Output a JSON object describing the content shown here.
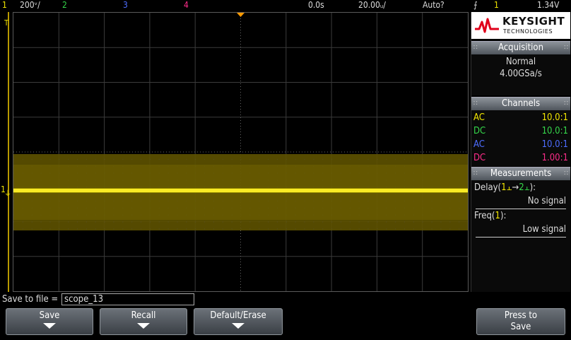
{
  "topbar": {
    "ch1_num": "1",
    "ch1_scale": "200ᵛ/",
    "ch2_num": "2",
    "ch3_num": "3",
    "ch4_num": "4",
    "delay": "0.0s",
    "timebase": "20.00ᵤ/",
    "trigger_mode": "Auto?",
    "trigger_ch": "1",
    "trigger_level": "1.34V"
  },
  "markers": {
    "trigger_t": "T",
    "ch1_ground": "1"
  },
  "logo": {
    "brand": "KEYSIGHT",
    "sub": "TECHNOLOGIES"
  },
  "acquisition": {
    "header": "Acquisition",
    "mode": "Normal",
    "rate": "4.00GSa/s"
  },
  "channels": {
    "header": "Channels",
    "rows": [
      {
        "coupling": "AC",
        "probe": "10.0:1",
        "color": "#f2e600"
      },
      {
        "coupling": "DC",
        "probe": "10.0:1",
        "color": "#35d64a"
      },
      {
        "coupling": "AC",
        "probe": "10.0:1",
        "color": "#4d6dff"
      },
      {
        "coupling": "DC",
        "probe": "1.00:1",
        "color": "#ff2d8a"
      }
    ]
  },
  "measurements": {
    "header": "Measurements",
    "items": [
      {
        "label_prefix": "Delay(",
        "label_a": "1⫠",
        "label_arrow": "→",
        "label_b": "2⫠",
        "label_suffix": "):",
        "value": "No signal"
      },
      {
        "label_prefix": "Freq(",
        "label_a": "1",
        "label_suffix": "):",
        "value": "Low signal"
      }
    ]
  },
  "savebar": {
    "label": "Save to file =",
    "filename": "scope_13"
  },
  "softkeys": {
    "save": "Save",
    "recall": "Recall",
    "default_erase": "Default/Erase",
    "press_to": "Press to",
    "press_save": "Save"
  },
  "colors": {
    "ch1": "#f2e600",
    "ch2": "#35d64a",
    "ch3": "#4d6dff",
    "ch4": "#ff2d8a",
    "trigger": "#ff9a00"
  }
}
